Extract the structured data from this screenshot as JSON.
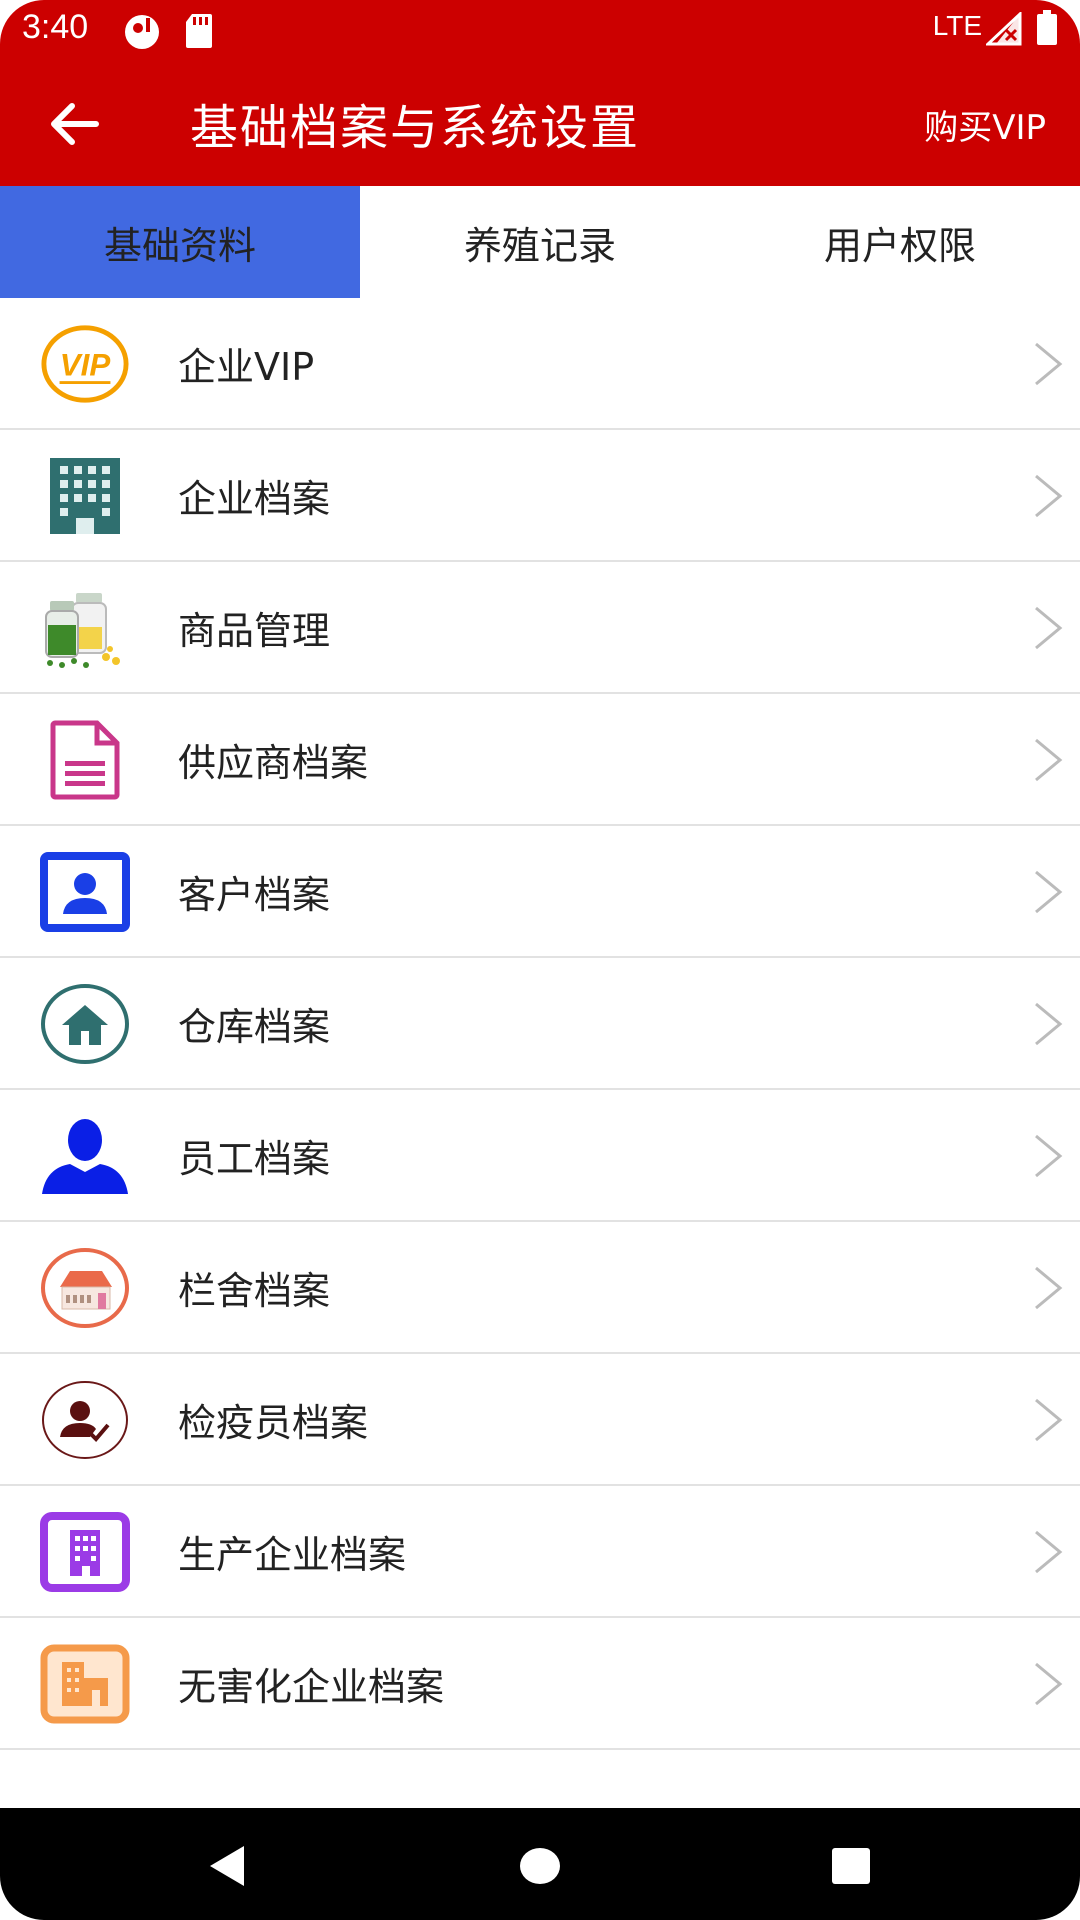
{
  "status_bar": {
    "time": "3:40",
    "network": "LTE",
    "icons": [
      "notification-icon",
      "sd-card-icon",
      "signal-icon",
      "battery-icon"
    ]
  },
  "app_bar": {
    "title": "基础档案与系统设置",
    "action_label": "购买VIP",
    "back_icon": "arrow-left-icon",
    "background_color": "#cc0000"
  },
  "tabs": [
    {
      "label": "基础资料",
      "active": true
    },
    {
      "label": "养殖记录",
      "active": false
    },
    {
      "label": "用户权限",
      "active": false
    }
  ],
  "accent_color": "#4169e1",
  "list": {
    "items": [
      {
        "label": "企业VIP",
        "icon": "vip-icon"
      },
      {
        "label": "企业档案",
        "icon": "office-building-icon"
      },
      {
        "label": "商品管理",
        "icon": "medicine-bottles-icon"
      },
      {
        "label": "供应商档案",
        "icon": "document-icon"
      },
      {
        "label": "客户档案",
        "icon": "contact-card-icon"
      },
      {
        "label": "仓库档案",
        "icon": "warehouse-home-icon"
      },
      {
        "label": "员工档案",
        "icon": "person-icon"
      },
      {
        "label": "栏舍档案",
        "icon": "barn-icon"
      },
      {
        "label": "检疫员档案",
        "icon": "inspector-check-icon"
      },
      {
        "label": "生产企业档案",
        "icon": "factory-building-icon"
      },
      {
        "label": "无害化企业档案",
        "icon": "harmless-facility-icon"
      }
    ]
  },
  "nav_bar": {
    "icons": [
      "back-triangle-icon",
      "home-circle-icon",
      "recents-square-icon"
    ]
  }
}
